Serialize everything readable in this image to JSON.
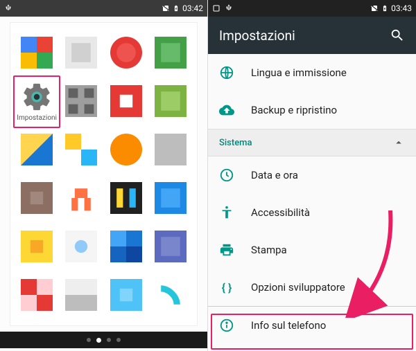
{
  "left_screen": {
    "status_time": "03:42",
    "app_label": "Impostazioni",
    "highlight_color": "#e91e63"
  },
  "right_screen": {
    "status_time": "03:43",
    "toolbar_title": "Impostazioni",
    "rows": {
      "lang": "Lingua e immissione",
      "backup": "Backup e ripristino",
      "date": "Data e ora",
      "access": "Accessibilità",
      "print": "Stampa",
      "dev": "Opzioni sviluppatore",
      "about": "Info sul telefono"
    },
    "section_title": "Sistema",
    "icons": {
      "lang": "globe-icon",
      "backup": "cloud-upload-icon",
      "date": "clock-icon",
      "access": "accessibility-icon",
      "print": "printer-icon",
      "dev": "braces-icon",
      "about": "info-icon",
      "search": "search-icon",
      "chevron": "chevron-up-icon"
    },
    "accent_color": "#009688"
  }
}
